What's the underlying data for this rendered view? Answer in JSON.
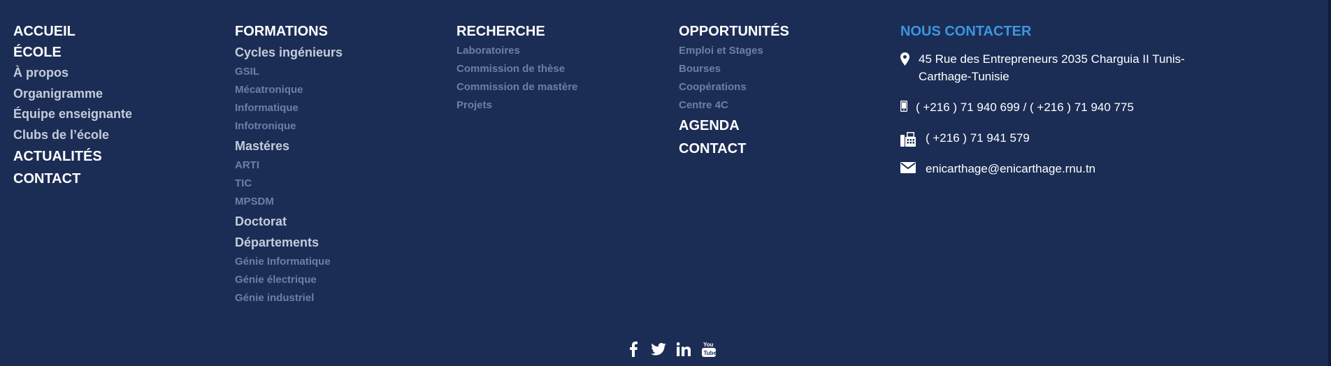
{
  "col1": {
    "accueil": "ACCUEIL",
    "ecole": "ÉCOLE",
    "items": [
      "À propos",
      "Organigramme",
      "Équipe enseignante",
      "Clubs de l’école"
    ],
    "actualites": "ACTUALITÉS",
    "contact": "CONTACT"
  },
  "col2": {
    "title": "FORMATIONS",
    "cycles": "Cycles ingénieurs",
    "cycles_items": [
      "GSIL",
      "Mécatronique",
      "Informatique",
      "Infotronique"
    ],
    "masteres": "Mastéres",
    "masteres_items": [
      "ARTI",
      "TIC",
      "MPSDM"
    ],
    "doctorat": "Doctorat",
    "departements": "Départements",
    "departements_items": [
      "Génie Informatique",
      "Génie électrique",
      "Génie industriel"
    ]
  },
  "col3": {
    "title": "RECHERCHE",
    "items": [
      "Laboratoires",
      "Commission de thèse",
      "Commission de mastère",
      "Projets"
    ]
  },
  "col4": {
    "title": "OPPORTUNITÉS",
    "items": [
      "Emploi et Stages",
      "Bourses",
      "Coopérations",
      "Centre 4C"
    ],
    "agenda": "AGENDA",
    "contact": "CONTACT"
  },
  "contact": {
    "title": "NOUS CONTACTER",
    "address": "45 Rue des Entrepreneurs 2035 Charguia II Tunis-Carthage-Tunisie",
    "phone": "( +216 ) 71 940 699 / ( +216 ) 71 940 775",
    "fax": "( +216 ) 71 941 579",
    "email": "enicarthage@enicarthage.rnu.tn"
  },
  "icons": {
    "address": "map-marker-icon",
    "phone": "mobile-phone-icon",
    "fax": "fax-icon",
    "email": "envelope-icon",
    "social": [
      "facebook-icon",
      "twitter-icon",
      "linkedin-icon",
      "youtube-icon"
    ]
  },
  "colors": {
    "background": "#1b2d55",
    "accent": "#3d95e0",
    "muted": "#6f7fa3",
    "light": "#c4cbda"
  }
}
